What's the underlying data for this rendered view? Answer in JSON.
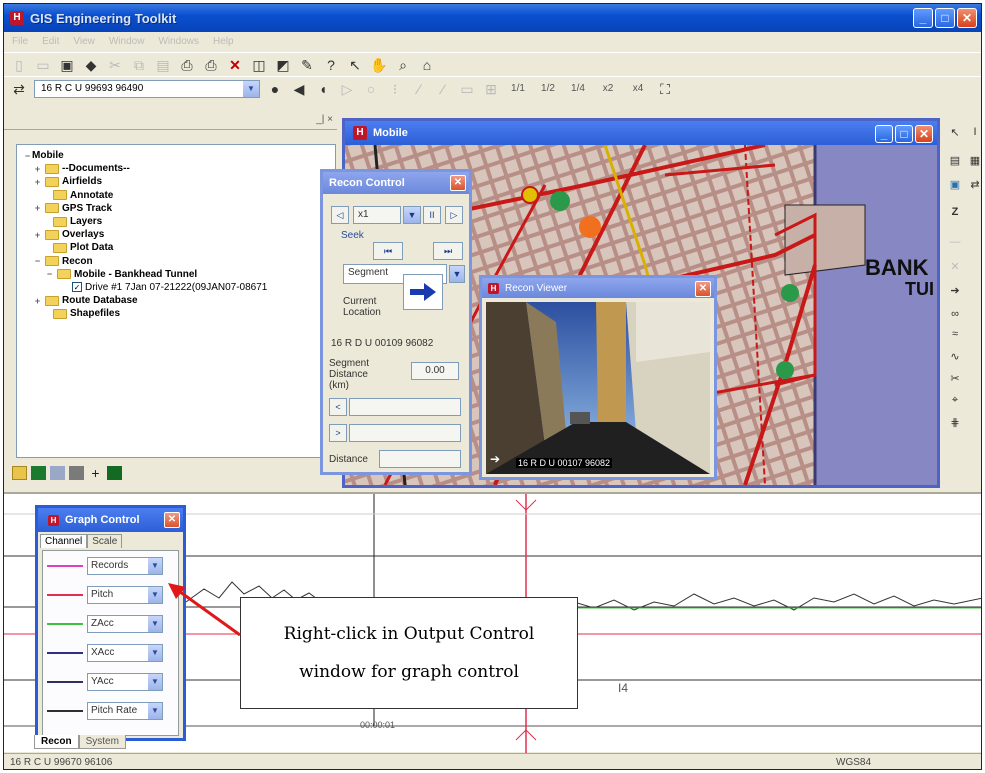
{
  "app": {
    "title": "GIS Engineering Toolkit",
    "icon": "app-logo-icon"
  },
  "menu": [
    "File",
    "Edit",
    "View",
    "Window",
    "Windows",
    "Help"
  ],
  "toolbar": {
    "coordinate": "16 R C U 99693 96490",
    "zoom_levels": [
      "1/1",
      "1/2",
      "1/4",
      "x2",
      "x4"
    ]
  },
  "tree": {
    "items": [
      {
        "label": "Mobile",
        "expander": "−",
        "type": "root"
      },
      {
        "label": "--Documents--",
        "expander": "+",
        "type": "folder"
      },
      {
        "label": "Airfields",
        "expander": "+",
        "type": "folder"
      },
      {
        "label": "Annotate",
        "expander": "",
        "type": "folder"
      },
      {
        "label": "GPS Track",
        "expander": "+",
        "type": "folder"
      },
      {
        "label": "Layers",
        "expander": "",
        "type": "folder"
      },
      {
        "label": "Overlays",
        "expander": "+",
        "type": "folder"
      },
      {
        "label": "Plot Data",
        "expander": "",
        "type": "folder"
      },
      {
        "label": "Recon",
        "expander": "−",
        "type": "folder"
      },
      {
        "label": "Mobile - Bankhead Tunnel",
        "expander": "−",
        "type": "folder"
      },
      {
        "label": "Drive #1 7Jan 07-21222(09JAN07-08671",
        "expander": "",
        "type": "check"
      },
      {
        "label": "Route Database",
        "expander": "+",
        "type": "folder"
      },
      {
        "label": "Shapefiles",
        "expander": "",
        "type": "folder"
      }
    ]
  },
  "map_window": {
    "title": "Mobile",
    "map_label_1": "BANK",
    "map_label_2": "TUI"
  },
  "recon_control": {
    "title": "Recon Control",
    "speed": "x1",
    "seek_label": "Seek",
    "mode": "Segment",
    "current_location_label": "Current Location",
    "location_value": "16 R D U 00109 96082",
    "segment_distance_label": "Segment Distance (km)",
    "segment_distance_value": "0.00",
    "distance_label": "Distance"
  },
  "video_window": {
    "title": "Recon Viewer",
    "overlay_coord": "16 R D U 00107 96082"
  },
  "graph_control": {
    "title": "Graph Control",
    "tabs": [
      "Channel",
      "Scale"
    ],
    "channels": [
      {
        "name": "Records",
        "color": "#e040c0"
      },
      {
        "name": "Pitch",
        "color": "#e03050"
      },
      {
        "name": "ZAcc",
        "color": "#40c040"
      },
      {
        "name": "XAcc",
        "color": "#303080"
      },
      {
        "name": "YAcc",
        "color": "#303060"
      },
      {
        "name": "Pitch Rate",
        "color": "#303030"
      }
    ]
  },
  "callout": {
    "line1": "Right-click in Output Control",
    "line2": "window for graph control"
  },
  "graph": {
    "time_label": "00:00:01",
    "marker": "I4"
  },
  "output_tabs": [
    "Recon",
    "System"
  ],
  "status": {
    "coordinate": "16 R C U 99670 96106",
    "datum": "WGS84"
  }
}
